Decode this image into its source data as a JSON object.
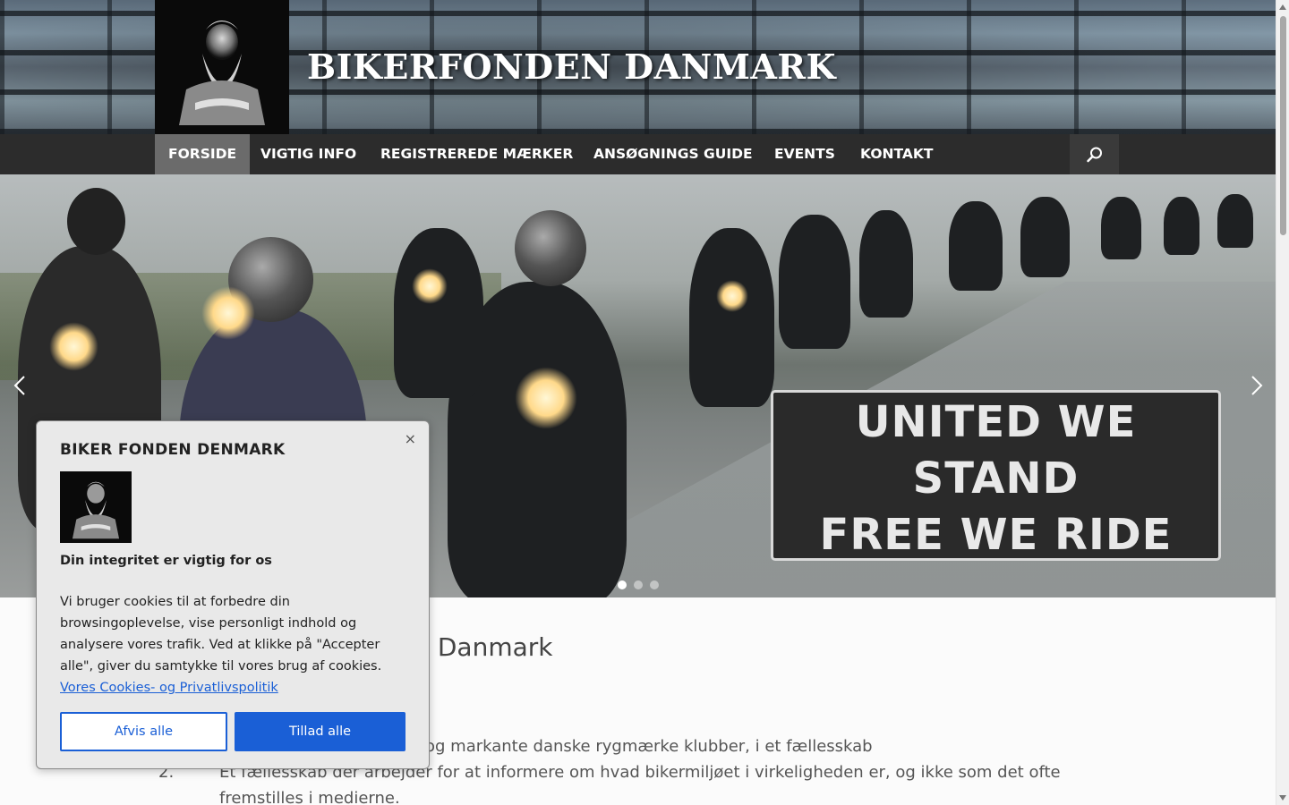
{
  "header": {
    "site_title": "BIKERFONDEN DANMARK",
    "logo_icon": "bearded-warrior-logo"
  },
  "nav": {
    "items": [
      {
        "label": "FORSIDE",
        "active": true
      },
      {
        "label": "VIGTIG INFO",
        "active": false
      },
      {
        "label": "REGISTREREDE MÆRKER",
        "active": false
      },
      {
        "label": "ANSØGNINGS GUIDE",
        "active": false
      },
      {
        "label": "EVENTS",
        "active": false
      },
      {
        "label": "KONTAKT",
        "active": false
      }
    ],
    "search_icon": "search-icon"
  },
  "slider": {
    "caption_line1": "UNITED WE",
    "caption_line2": "STAND",
    "caption_line3": "FREE WE RIDE",
    "slide_count": 3,
    "active_slide": 1
  },
  "content": {
    "heading_partial": "en Danmark",
    "list": [
      {
        "num": "",
        "text": "og markante danske rygmærke klubber, i et fællesskab"
      },
      {
        "num": "2.",
        "text": "Et fællesskab der arbejder for at informere om hvad bikermiljøet i virkeligheden er, og ikke som det ofte fremstilles i medierne."
      }
    ]
  },
  "cookie": {
    "title": "BIKER FONDEN DENMARK",
    "subtitle": "Din integritet er vigtig for os",
    "body": "Vi bruger cookies til at forbedre din browsingoplevelse, vise personligt indhold og analysere vores trafik. Ved at klikke på \"Accepter alle\", giver du samtykke til vores brug af cookies.",
    "link": "Vores Cookies- og Privatlivspolitik",
    "reject_label": "Afvis alle",
    "accept_label": "Tillad alle",
    "close_label": "×"
  },
  "colors": {
    "nav_bg": "#2c2c2c",
    "nav_active": "#6b6b6b",
    "accent_blue": "#1a5fd6"
  }
}
